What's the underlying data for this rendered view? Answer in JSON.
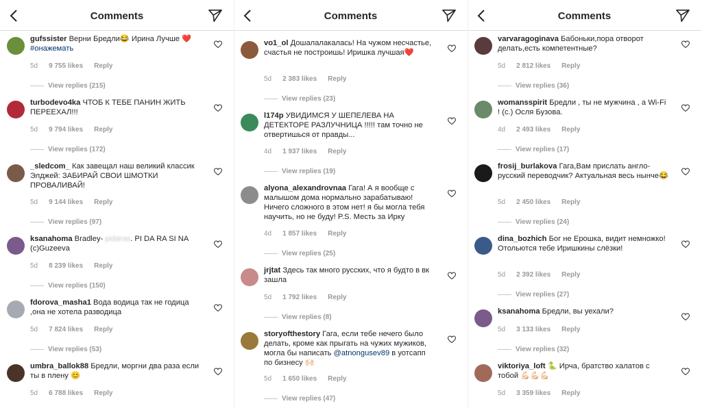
{
  "panels": [
    {
      "title": "Comments",
      "comments": [
        {
          "user": "gufssister",
          "parts": [
            {
              "t": "Верни Бредли😂 Ирина Лучше ❤️ "
            },
            {
              "t": "#онажемать",
              "k": "tag"
            }
          ],
          "age": "5d",
          "likes": "9 755 likes",
          "reply": "Reply",
          "view_replies": "View replies (215)",
          "avatar_color": "#6b8f3a"
        },
        {
          "user": "turbodevo4ka",
          "parts": [
            {
              "t": "ЧТОБ К ТЕБЕ ПАНИН ЖИТЬ ПЕРЕЕХАЛ!!!"
            }
          ],
          "age": "5d",
          "likes": "9 794 likes",
          "reply": "Reply",
          "view_replies": "View replies (172)",
          "avatar_color": "#b22a3a"
        },
        {
          "user": "_sledcom_",
          "parts": [
            {
              "t": "Как завещал наш великий классик Элджей: ЗАБИРАЙ СВОИ ШМОТКИ ПРОВАЛИВАЙ!"
            }
          ],
          "age": "5d",
          "likes": "9 144 likes",
          "reply": "Reply",
          "view_replies": "View replies (97)",
          "avatar_color": "#7a5a4a"
        },
        {
          "user": "ksanahoma",
          "parts": [
            {
              "t": "Bradley- "
            },
            {
              "t": "pidaras",
              "k": "blur"
            },
            {
              "t": ". PI DA RA SI NA (c)Guzeeva"
            }
          ],
          "age": "5d",
          "likes": "8 239 likes",
          "reply": "Reply",
          "view_replies": "View replies (150)",
          "avatar_color": "#7b5a8c"
        },
        {
          "user": "fdorova_masha1",
          "parts": [
            {
              "t": "Вода водица так не годица ,она не хотела разводица"
            }
          ],
          "age": "5d",
          "likes": "7 824 likes",
          "reply": "Reply",
          "view_replies": "View replies (53)",
          "avatar_color": "#a7a9b3"
        },
        {
          "user": "umbra_ballok88",
          "parts": [
            {
              "t": "Бредли, моргни два раза если ты в плену 😊"
            }
          ],
          "age": "5d",
          "likes": "6 788 likes",
          "reply": "Reply",
          "view_replies": "",
          "avatar_color": "#4a3328"
        }
      ]
    },
    {
      "title": "Comments",
      "comments": [
        {
          "user": "vo1_ol",
          "parts": [
            {
              "t": "Дошалалакалась! На чужом несчастье, счастья не построишь! Иришка лучшая❤️"
            }
          ],
          "age": "5d",
          "likes": "2 383 likes",
          "reply": "Reply",
          "view_replies": "View replies (23)",
          "avatar_color": "#8b5a3c"
        },
        {
          "user": "l174p",
          "parts": [
            {
              "t": "УВИДИМСЯ У ШЕПЕЛЕВА НА ДЕТЕКТОРЕ РАЗЛУЧНИЦА !!!!! там точно не отвертишься от правды..."
            }
          ],
          "age": "4d",
          "likes": "1 937 likes",
          "reply": "Reply",
          "view_replies": "View replies (19)",
          "avatar_color": "#3a8a5a"
        },
        {
          "user": "alyona_alexandrovnaa",
          "parts": [
            {
              "t": "Гага! А я вообще с малышом дома нормально зарабатываю! Ничего сложного в этом нет! я бы могла тебя научить, но не буду! P.S. Месть за Ирку"
            }
          ],
          "age": "4d",
          "likes": "1 857 likes",
          "reply": "Reply",
          "view_replies": "View replies (25)",
          "avatar_color": "#8c8c8c"
        },
        {
          "user": "jrjtat",
          "parts": [
            {
              "t": "Здесь так много русских, что я будто в вк зашла"
            }
          ],
          "age": "5d",
          "likes": "1 792 likes",
          "reply": "Reply",
          "view_replies": "View replies (8)",
          "avatar_color": "#c98a8a"
        },
        {
          "user": "storyofthestory",
          "parts": [
            {
              "t": "Гага, если тебе нечего было делать, кроме как прыгать на чужих мужиков, могла бы написать "
            },
            {
              "t": "@atnongusev89",
              "k": "tag"
            },
            {
              "t": " в уотсапп по бизнесу 🙌🏻"
            }
          ],
          "age": "5d",
          "likes": "1 650 likes",
          "reply": "Reply",
          "view_replies": "View replies (47)",
          "avatar_color": "#9a7a3a"
        }
      ]
    },
    {
      "title": "Comments",
      "comments": [
        {
          "user": "varvaragoginava",
          "parts": [
            {
              "t": "Бабоньки,пора отворот делать,есть компетентные?"
            }
          ],
          "age": "5d",
          "likes": "2 812 likes",
          "reply": "Reply",
          "view_replies": "View replies (36)",
          "avatar_color": "#5a3a3a"
        },
        {
          "user": "womansspirit",
          "parts": [
            {
              "t": "Бредли , ты не мужчина , а Wi-Fi ! (с.) Осля Бузова."
            }
          ],
          "age": "4d",
          "likes": "2 493 likes",
          "reply": "Reply",
          "view_replies": "View replies (17)",
          "avatar_color": "#6a8a6a"
        },
        {
          "user": "frosij_burlakova",
          "parts": [
            {
              "t": "Гага,Вам прислать англо-русский переводчик? Актуальная весь нынче😂"
            }
          ],
          "age": "5d",
          "likes": "2 450 likes",
          "reply": "Reply",
          "view_replies": "View replies (24)",
          "avatar_color": "#1a1a1a"
        },
        {
          "user": "dina_bozhich",
          "parts": [
            {
              "t": "Бог не Ерошка, видит немножко! Отольются тебе Иришкины слёзки!"
            }
          ],
          "age": "5d",
          "likes": "2 392 likes",
          "reply": "Reply",
          "view_replies": "View replies (27)",
          "avatar_color": "#3a5a8a"
        },
        {
          "user": "ksanahoma",
          "parts": [
            {
              "t": "Бредли, вы уехали?"
            }
          ],
          "age": "5d",
          "likes": "3 133 likes",
          "reply": "Reply",
          "view_replies": "View replies (32)",
          "avatar_color": "#7b5a8c"
        },
        {
          "user": "viktoriya_loft",
          "parts": [
            {
              "t": "🐍 Ирча, братство халатов с тобой 💪🏻💪🏻💪🏻"
            }
          ],
          "age": "5d",
          "likes": "3 359 likes",
          "reply": "Reply",
          "view_replies": "",
          "avatar_color": "#a06a5a"
        }
      ]
    }
  ]
}
